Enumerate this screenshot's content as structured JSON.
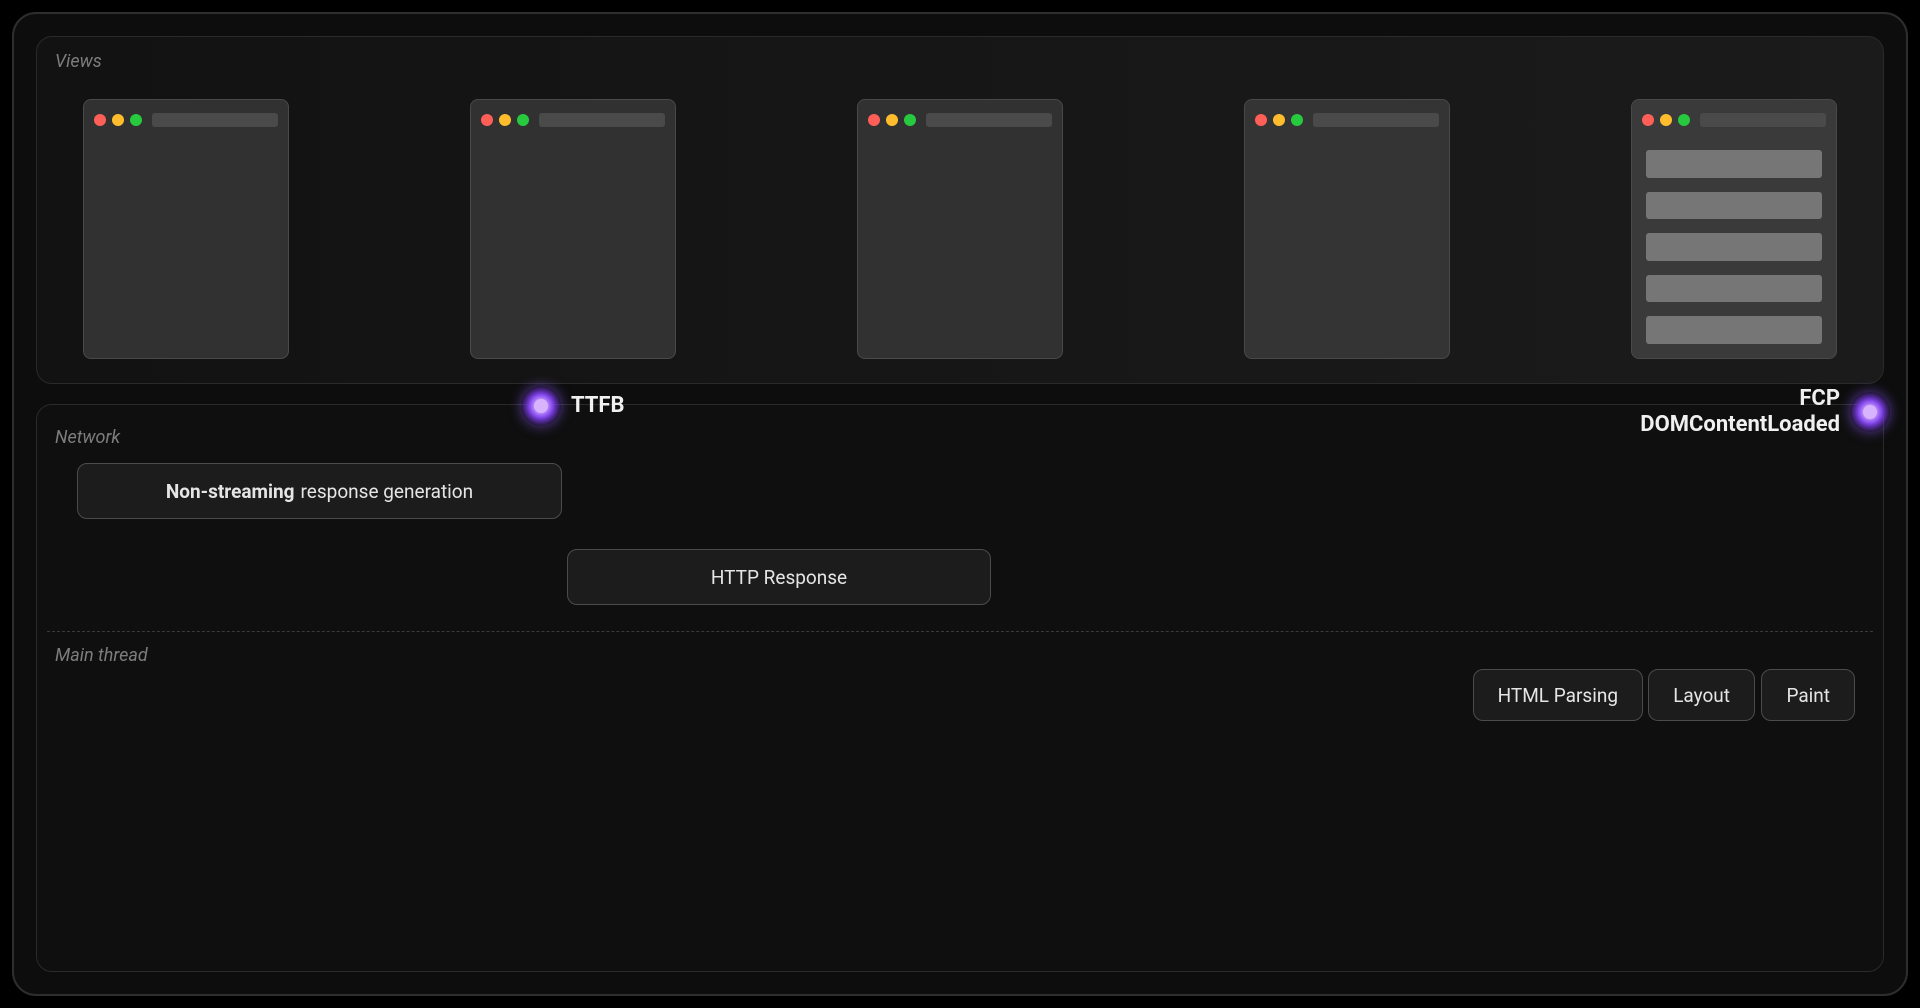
{
  "sections": {
    "views": "Views",
    "network": "Network",
    "main_thread": "Main thread"
  },
  "markers": {
    "ttfb": "TTFB",
    "fcp_line1": "FCP",
    "fcp_line2": "DOMContentLoaded"
  },
  "network": {
    "gen_strong": "Non-streaming",
    "gen_rest": "response generation",
    "http": "HTTP Response"
  },
  "thread": {
    "parse": "HTML Parsing",
    "layout": "Layout",
    "paint": "Paint"
  }
}
